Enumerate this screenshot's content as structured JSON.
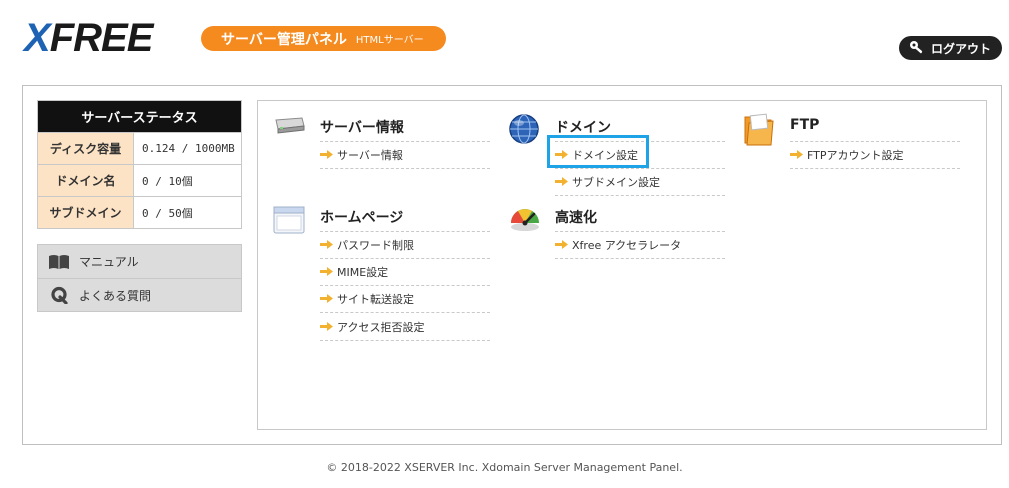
{
  "header": {
    "logo_text": "XFREE",
    "badge_main": "サーバー管理パネル",
    "badge_sub": "HTMLサーバー",
    "logout_label": "ログアウト"
  },
  "status": {
    "title": "サーバーステータス",
    "rows": [
      {
        "label": "ディスク容量",
        "value": "0.124 / 1000MB"
      },
      {
        "label": "ドメイン名",
        "value": "0 / 10個"
      },
      {
        "label": "サブドメイン",
        "value": "0 / 50個"
      }
    ]
  },
  "sidemenu": {
    "items": [
      {
        "label": "マニュアル",
        "icon": "book-icon"
      },
      {
        "label": "よくある質問",
        "icon": "q-icon"
      }
    ]
  },
  "sections": {
    "server": {
      "title": "サーバー情報",
      "icon": "server-icon",
      "links": [
        "サーバー情報"
      ]
    },
    "domain": {
      "title": "ドメイン",
      "icon": "globe-icon",
      "links": [
        "ドメイン設定",
        "サブドメイン設定"
      ]
    },
    "ftp": {
      "title": "FTP",
      "icon": "folder-icon",
      "links": [
        "FTPアカウント設定"
      ]
    },
    "homepage": {
      "title": "ホームページ",
      "icon": "window-icon",
      "links": [
        "パスワード制限",
        "MIME設定",
        "サイト転送設定",
        "アクセス拒否設定"
      ]
    },
    "speed": {
      "title": "高速化",
      "icon": "gauge-icon",
      "links": [
        "Xfree アクセラレータ"
      ]
    }
  },
  "footer": "© 2018-2022 XSERVER Inc. Xdomain Server Management Panel.",
  "colors": {
    "accent": "#f58a1f",
    "highlight": "#1ea4e6",
    "status_key_bg": "#fde3c5"
  }
}
